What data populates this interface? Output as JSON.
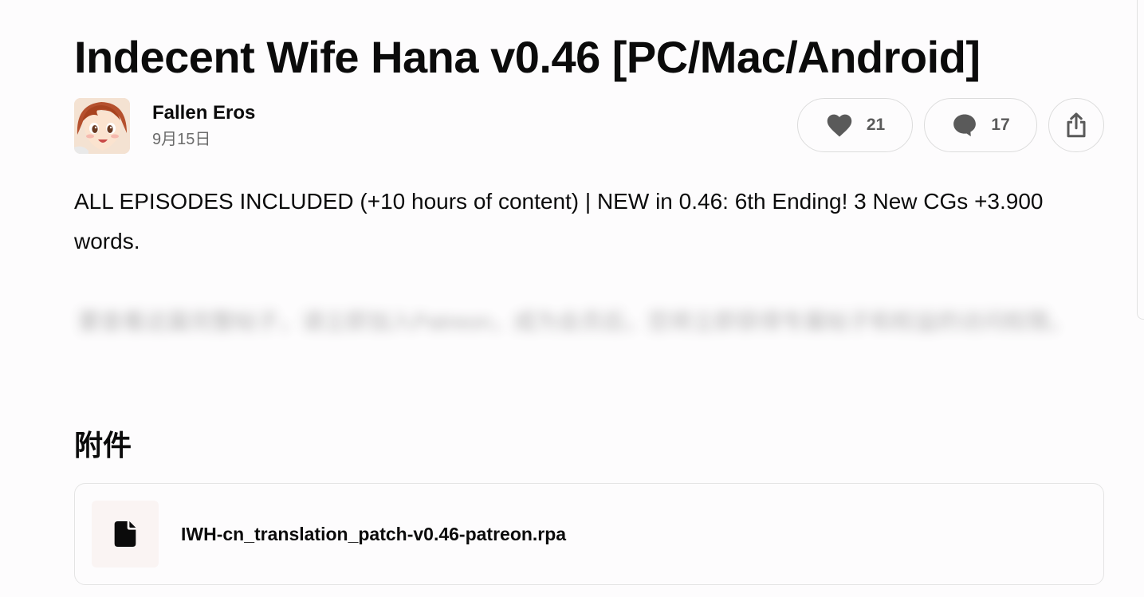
{
  "post": {
    "title": "Indecent Wife Hana v0.46 [PC/Mac/Android]",
    "author": "Fallen Eros",
    "date": "9月15日",
    "likes": "21",
    "comments": "17",
    "summary": "ALL EPISODES INCLUDED (+10 hours of content) | NEW in 0.46: 6th Ending! 3 New CGs +3.900 words.",
    "locked_text": "要查看这篇完整帖子，请立即加入Patreon，成为会员后，您将立即获得专属帖子和权益的访问权限。"
  },
  "attachments": {
    "heading": "附件",
    "files": [
      {
        "name": "IWH-cn_translation_patch-v0.46-patreon.rpa"
      }
    ]
  },
  "icons": {
    "like": "heart-icon",
    "comment": "speech-bubble-icon",
    "share": "share-icon",
    "file": "file-icon"
  },
  "colors": {
    "background": "#fdfcfd",
    "text": "#0b0b0b",
    "muted": "#6b6b6b",
    "icon": "#5a5a5a"
  }
}
